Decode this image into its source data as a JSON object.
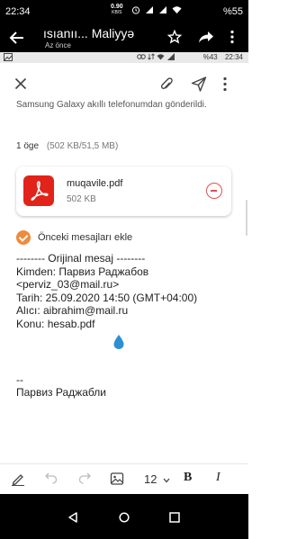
{
  "status_bar": {
    "time": "22:34",
    "net_speed": "0.90",
    "net_unit": "KB/S",
    "battery": "%55"
  },
  "app_header": {
    "title": "ısıanıı... Maliyyə",
    "subtitle": "Az önce"
  },
  "notif_bar": {
    "time": "22:34",
    "battery": "%43"
  },
  "email": {
    "sent_from": "Samsung Galaxy akıllı telefonumdan gönderildi.",
    "attachments_count": "1 öge",
    "attachments_sizes": "(502 KB/51,5 MB)",
    "attachment": {
      "filename": "muqavile.pdf",
      "size": "502 KB"
    },
    "include_previous_label": "Önceki mesajları ekle",
    "quoted": {
      "header": "-------- Orijinal mesaj --------",
      "from_line": "Kimden: Парвиз Раджабов",
      "from_email": "<perviz_03@mail.ru>",
      "date_line": "Tarih: 25.09.2020 14:50 (GMT+04:00)",
      "to_line": "Alıcı: aibrahim@mail.ru",
      "subject_line": "Konu: hesab.pdf"
    },
    "sig_dash": "--",
    "sig_name": "Парвиз Раджабли"
  },
  "format_bar": {
    "font_size": "12",
    "bold_label": "B",
    "italic_label": "I"
  },
  "icons": {
    "back": "back-arrow-icon",
    "star": "star-icon",
    "share": "share-icon",
    "more": "more-vertical-icon",
    "close": "close-icon",
    "attach": "paperclip-icon",
    "send": "send-icon",
    "pdf": "pdf-file-icon",
    "remove": "remove-circle-icon",
    "checkbox": "checked-circle-icon",
    "pen": "pen-icon",
    "undo": "undo-icon",
    "redo": "redo-icon",
    "image": "image-icon",
    "nav_back": "nav-back-icon",
    "nav_home": "nav-home-icon",
    "nav_recents": "nav-recents-icon"
  },
  "colors": {
    "accent_orange": "#f08a3c",
    "pdf_red": "#e2231a",
    "remove_red": "#e05050"
  }
}
